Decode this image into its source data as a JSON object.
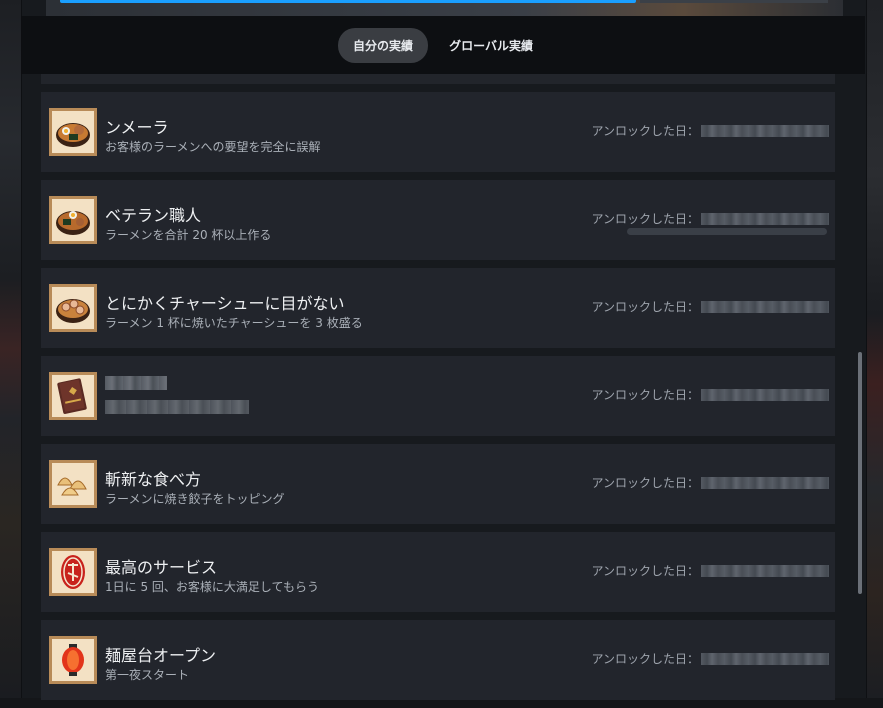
{
  "tabs": [
    {
      "label": "自分の実績",
      "active": true
    },
    {
      "label": "グローバル実績",
      "active": false
    }
  ],
  "unlock_label": "アンロックした日：",
  "achievements": [
    {
      "title": "ンメーラ",
      "desc": "お客様のラーメンへの要望を完全に誤解",
      "icon": "ramen-bowl-icon",
      "hidden": false,
      "progress": false
    },
    {
      "title": "ベテラン職人",
      "desc": "ラーメンを合計 20 杯以上作る",
      "icon": "ramen-bowl-icon",
      "hidden": false,
      "progress": true
    },
    {
      "title": "とにかくチャーシューに目がない",
      "desc": "ラーメン 1 杯に焼いたチャーシューを 3 枚盛る",
      "icon": "chashu-ramen-icon",
      "hidden": false,
      "progress": false
    },
    {
      "title": "",
      "desc": "",
      "icon": "book-icon",
      "hidden": true,
      "progress": false
    },
    {
      "title": "斬新な食べ方",
      "desc": "ラーメンに焼き餃子をトッピング",
      "icon": "gyoza-icon",
      "hidden": false,
      "progress": false
    },
    {
      "title": "最高のサービス",
      "desc": "1日に 5 回、お客様に大満足してもらう",
      "icon": "red-stamp-icon",
      "hidden": false,
      "progress": false
    },
    {
      "title": "麺屋台オープン",
      "desc": "第一夜スタート",
      "icon": "lantern-icon",
      "hidden": false,
      "progress": false
    }
  ],
  "colors": {
    "accent": "#1a9fff",
    "row_bg": "#22252c",
    "icon_frame": "#b88b58"
  }
}
